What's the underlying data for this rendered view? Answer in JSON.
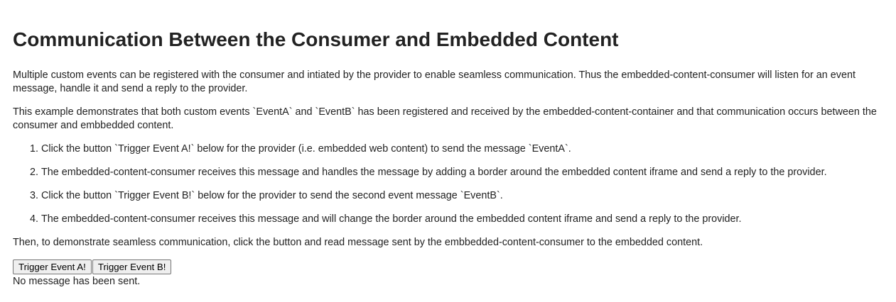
{
  "page": {
    "title": "Communication Between the Consumer and Embedded Content",
    "intro_1": "Multiple custom events can be registered with the consumer and intiated by the provider to enable seamless communication. Thus the embedded-content-consumer will listen for an event message, handle it and send a reply to the provider.",
    "intro_2": "This example demonstrates that both custom events `EventA` and `EventB` has been registered and received by the embedded-content-container and that communication occurs between the consumer and embbedded content.",
    "steps": [
      "Click the button `Trigger Event A!` below for the provider (i.e. embedded web content) to send the message `EventA`.",
      "The embedded-content-consumer receives this message and handles the message by adding a border around the embedded content iframe and send a reply to the provider.",
      "Click the button `Trigger Event B!` below for the provider to send the second event message `EventB`.",
      "The embedded-content-consumer receives this message and will change the border around the embedded content iframe and send a reply to the provider."
    ],
    "outro": "Then, to demonstrate seamless communication, click the button and read message sent by the embbedded-content-consumer to the embedded content."
  },
  "buttons": {
    "event_a_label": "Trigger Event A!",
    "event_b_label": "Trigger Event B!"
  },
  "status": {
    "message": "No message has been sent."
  }
}
